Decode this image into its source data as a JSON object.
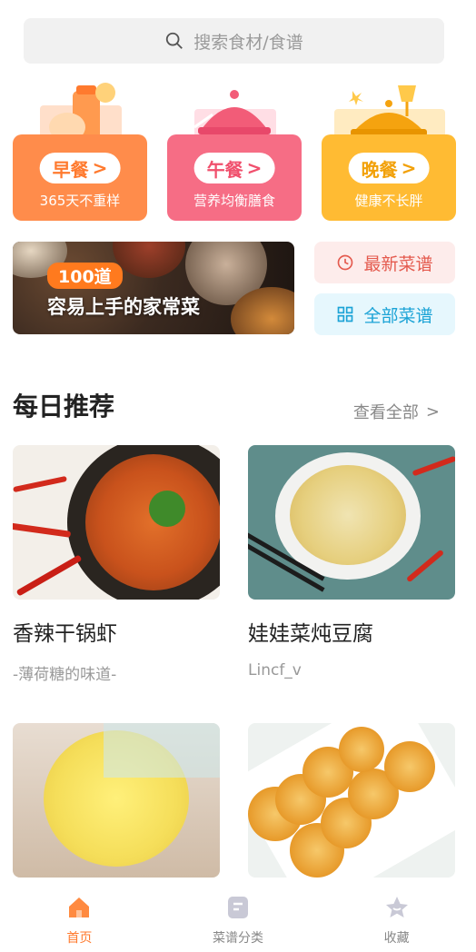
{
  "search": {
    "placeholder": "搜索食材/食谱",
    "icon": "search-icon"
  },
  "meals": [
    {
      "label": "早餐",
      "sub": "365天不重样",
      "color": "#ff8c4b"
    },
    {
      "label": "午餐",
      "sub": "营养均衡膳食",
      "color": "#f66d85"
    },
    {
      "label": "晚餐",
      "sub": "健康不长胖",
      "color": "#ffbb33"
    }
  ],
  "banner": {
    "tag": "100道",
    "title": "容易上手的家常菜"
  },
  "quick_links": {
    "latest": "最新菜谱",
    "all": "全部菜谱"
  },
  "section": {
    "title": "每日推荐",
    "more": "查看全部"
  },
  "recipes": [
    {
      "name": "香辣干锅虾",
      "author": "-薄荷糖的味道-"
    },
    {
      "name": "娃娃菜炖豆腐",
      "author": "Lincf_v"
    },
    {
      "name": "",
      "author": ""
    },
    {
      "name": "",
      "author": ""
    }
  ],
  "tabs": [
    {
      "label": "首页",
      "icon": "home-icon",
      "active": true
    },
    {
      "label": "菜谱分类",
      "icon": "recipe-book-icon",
      "active": false
    },
    {
      "label": "收藏",
      "icon": "star-icon",
      "active": false
    }
  ],
  "colors": {
    "accent": "#ff7a2e",
    "lunch": "#f66d85",
    "dinner": "#ffbb33",
    "latest": "#e45a4e",
    "all": "#1ba3d6"
  }
}
